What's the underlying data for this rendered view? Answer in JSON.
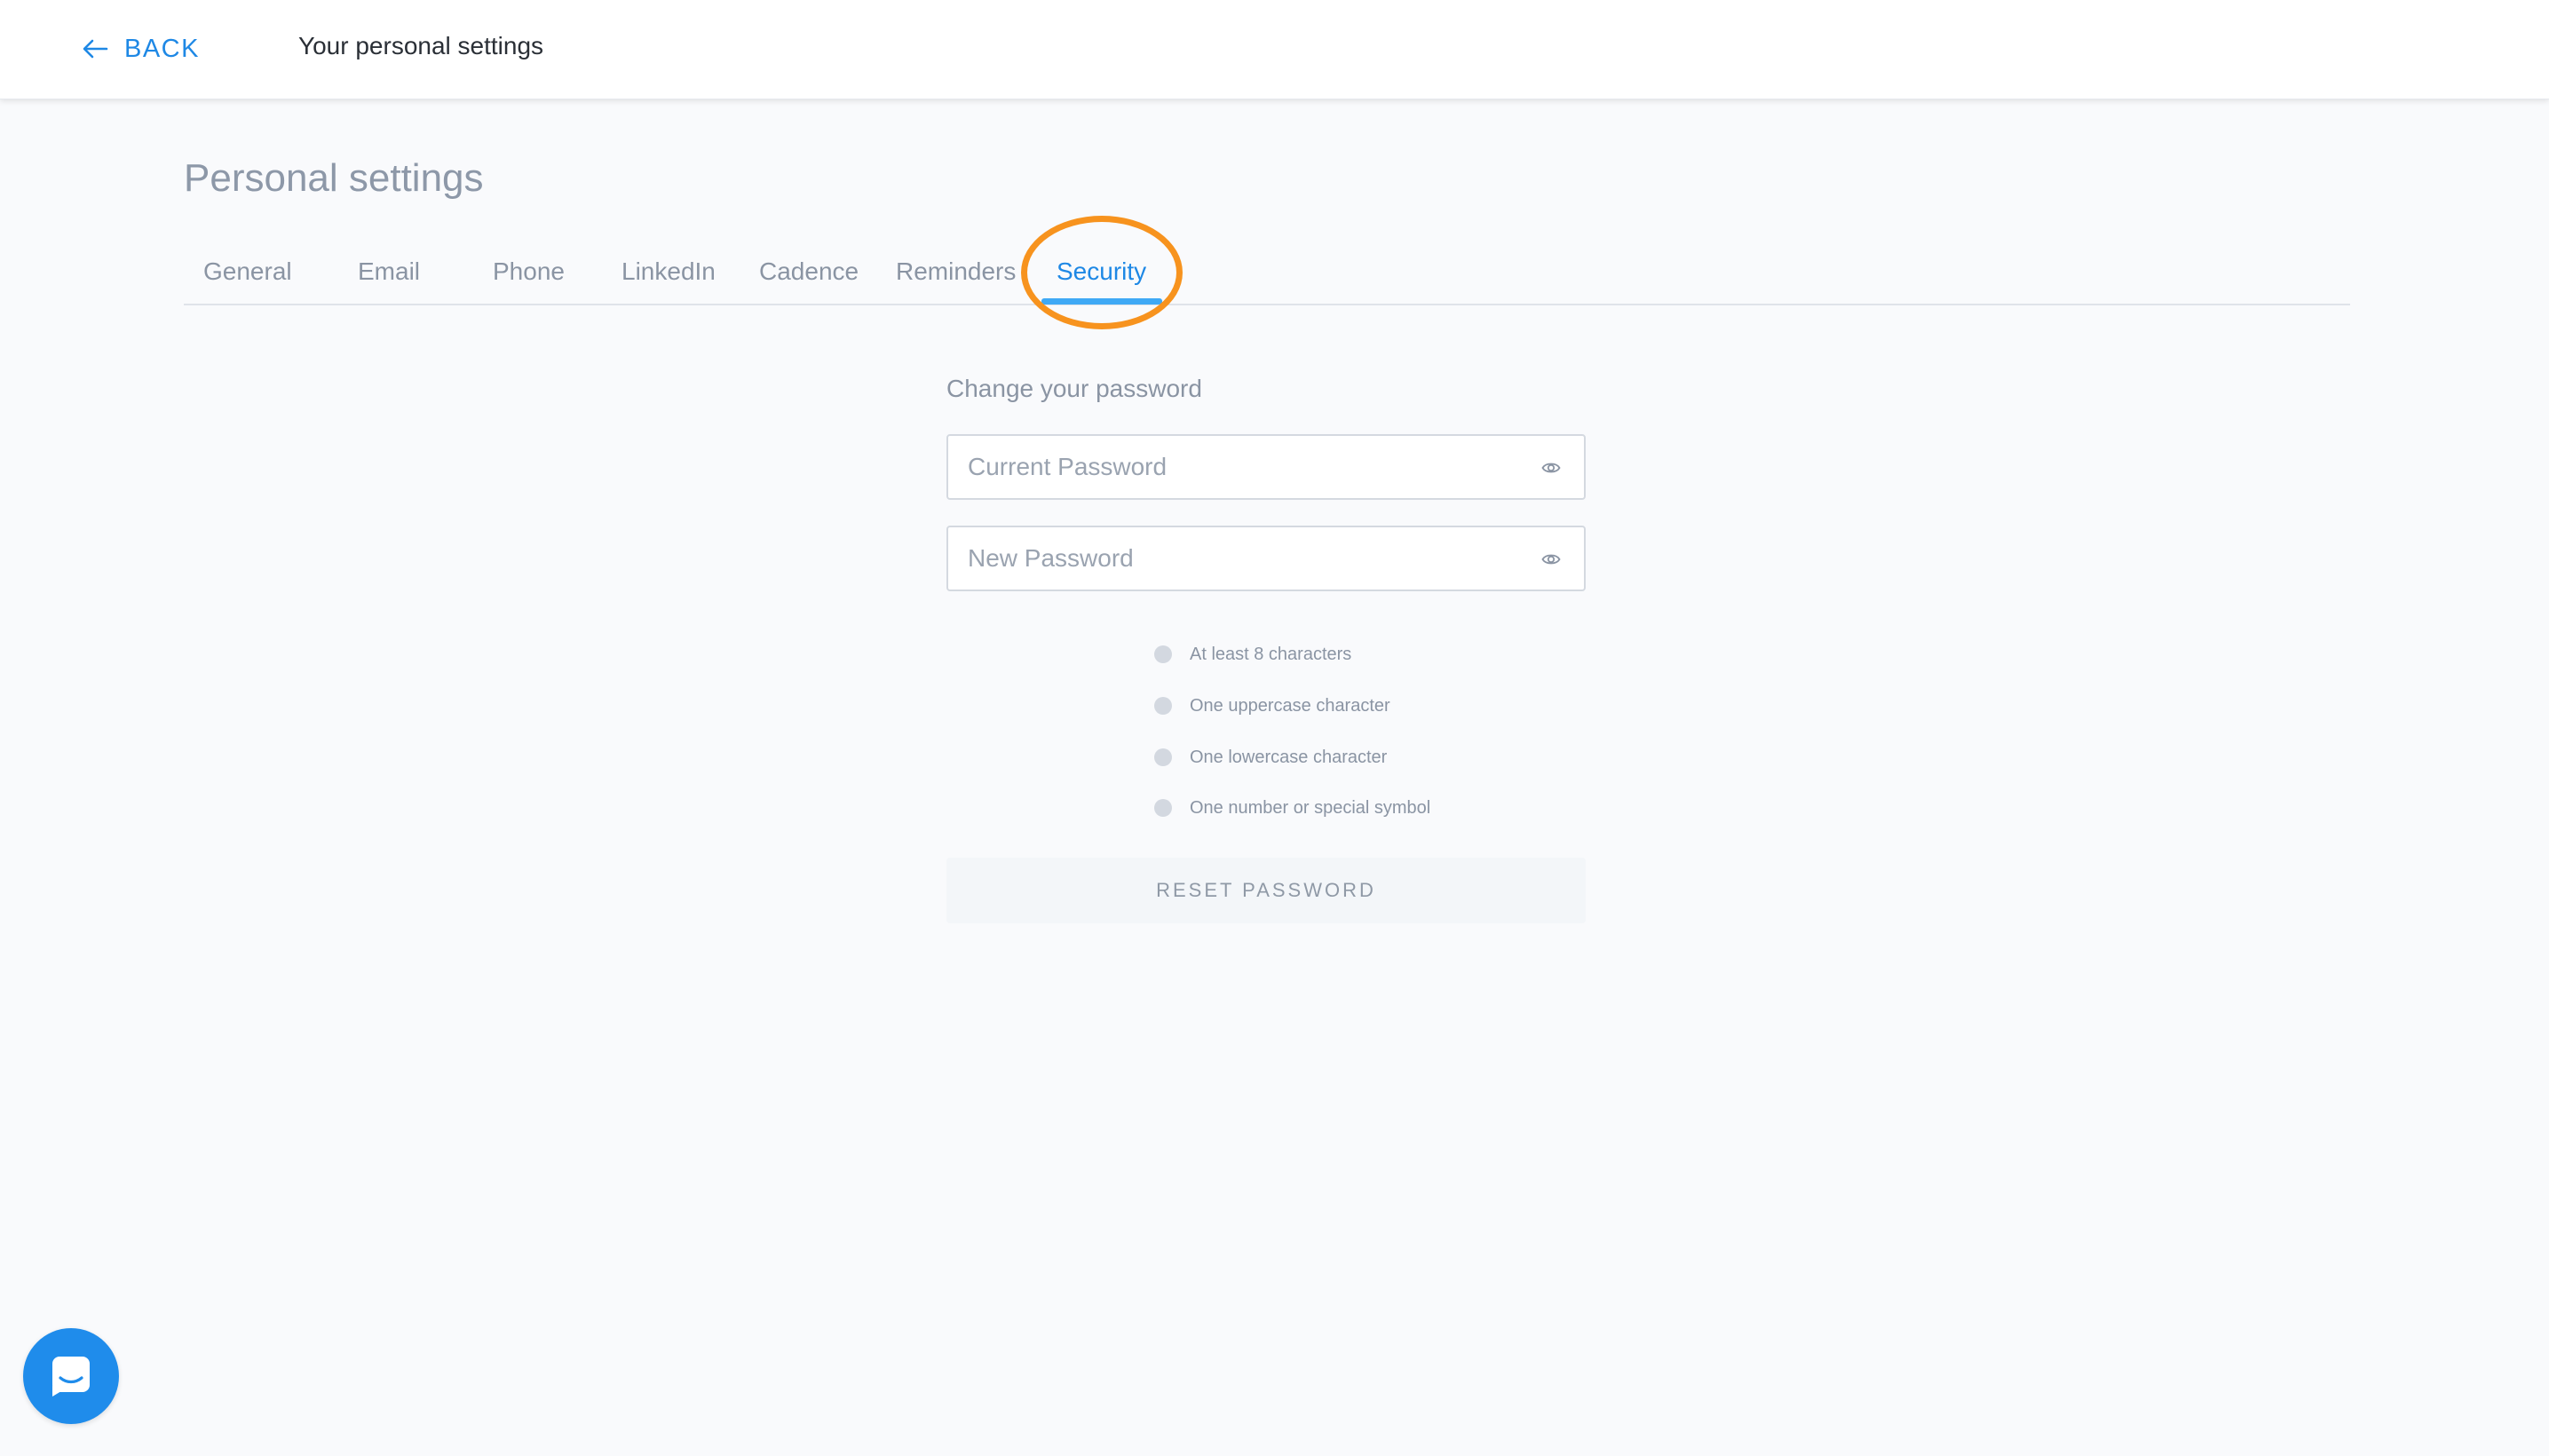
{
  "header": {
    "back_label": "BACK",
    "title": "Your personal settings"
  },
  "page": {
    "title": "Personal settings"
  },
  "tabs": [
    {
      "label": "General",
      "active": false
    },
    {
      "label": "Email",
      "active": false
    },
    {
      "label": "Phone",
      "active": false
    },
    {
      "label": "LinkedIn",
      "active": false
    },
    {
      "label": "Cadence",
      "active": false
    },
    {
      "label": "Reminders",
      "active": false
    },
    {
      "label": "Security",
      "active": true
    }
  ],
  "security": {
    "section_label": "Change your password",
    "current_password": {
      "value": "",
      "placeholder": "Current Password"
    },
    "new_password": {
      "value": "",
      "placeholder": "New Password"
    },
    "requirements": [
      "At least 8 characters",
      "One uppercase character",
      "One lowercase character",
      "One number or special symbol"
    ],
    "reset_button": "RESET PASSWORD"
  },
  "colors": {
    "accent": "#1e88e5",
    "tab_underline": "#3fa9f5",
    "highlight_ring": "#f7931e",
    "chat_button": "#1f8ceb"
  },
  "icons": {
    "back": "arrow-left-icon",
    "password_visibility": "eye-icon",
    "chat": "chat-messenger-icon"
  }
}
